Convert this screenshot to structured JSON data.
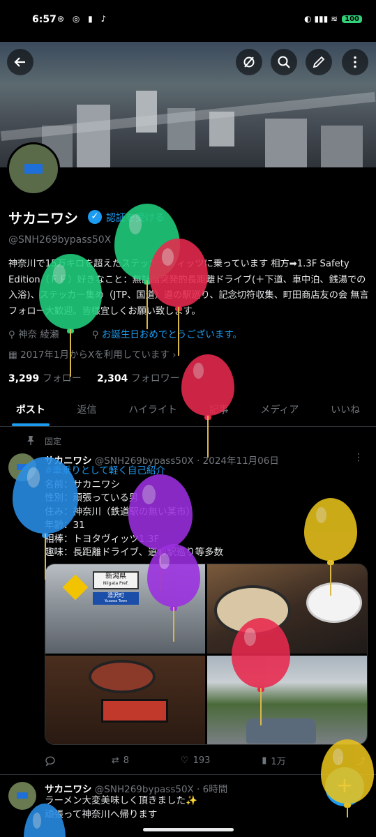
{
  "status_bar": {
    "time": "6:57",
    "app_icons": "⊛ ◎ ▮ ♪",
    "signal": "◐ ▮▮▮ ≋",
    "battery": "100"
  },
  "header": {
    "back_icon": "arrow-left-icon",
    "actions": [
      "grok-icon",
      "search-icon",
      "edit-icon",
      "more-icon"
    ]
  },
  "profile": {
    "name": "サカニワシ",
    "get_verified": "認証を受ける",
    "handle": "@SNH269bypass50X",
    "bio": "神奈川で15万キロを超えたステッカーヴィッツに乗っています 相方➡1.3F Safety Edition（ＦＦ）好きなこと：無計画突発的長距離ドライブ(＋下道、車中泊、銭湯での入浴)、ステッカー集め（JTP、国道）道の駅巡り、記念切符収集、町田商店友の会 無言フォロー大歓迎。皆様宜しくお願い致します。",
    "location": "神奈 綾瀬",
    "birthday": "お誕生日おめでとうございます。",
    "joined": "2017年1月からXを利用しています",
    "following_count": "3,299",
    "following_label": "フォロー",
    "followers_count": "2,304",
    "followers_label": "フォロワー"
  },
  "tabs": [
    "ポスト",
    "返信",
    "ハイライト",
    "記事",
    "メディア",
    "いいね"
  ],
  "pinned_post": {
    "pinned_label": "固定",
    "author": "サカニワシ",
    "handle_date": "@SNH269bypass50X · 2024年11月06日",
    "hashtag": "#車乗りとして軽く自己紹介",
    "lines": [
      "名前：サカニワシ",
      "性別：頑張っている男",
      "住み：神奈川（鉄道駅の無い某市）",
      "年齢：31",
      "相棒：トヨタヴィッツ1.3F",
      "趣味：長距離ドライブ、道の駅巡り等多数"
    ],
    "media_sign_1": "新潟県",
    "media_sign_1_en": "Niigata Pref.",
    "media_sign_2": "湯沢町",
    "media_sign_2_en": "Yuzawa Town",
    "replies": "",
    "reposts": "8",
    "likes": "193",
    "views": "1万"
  },
  "second_post": {
    "author": "サカニワシ",
    "handle_time": "@SNH269bypass50X · 6時間",
    "line1": "ラーメン大変美味しく頂きました✨",
    "line2": "頑張って神奈川へ帰ります"
  },
  "fab_label": "+",
  "colors": {
    "accent": "#1d9bf0",
    "balloon_green": "#22d07e",
    "balloon_red": "#e8294e",
    "balloon_blue": "#2a8fe8",
    "balloon_purple": "#9b2fe0",
    "balloon_yellow": "#e8c21c"
  }
}
